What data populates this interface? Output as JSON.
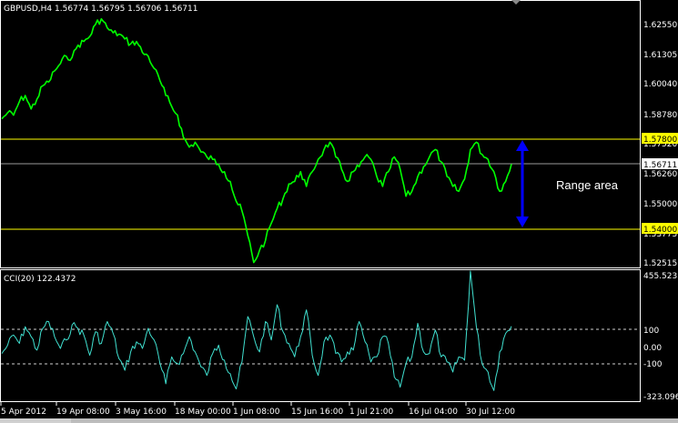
{
  "main_panel": {
    "title": "GBPUSD,H4  1.56774 1.56795 1.56706 1.56711",
    "price_labels": [
      "1.62550",
      "1.61305",
      "1.60040",
      "1.58780",
      "1.57520",
      "1.56260",
      "1.55000",
      "1.53775",
      "1.52515"
    ],
    "current_price": "1.56711",
    "upper_level": "1.57800",
    "lower_level": "1.54000",
    "annotation": "Range area"
  },
  "cci_panel": {
    "title": "CCI(20) 122.4372",
    "labels": [
      "455.5233",
      "100",
      "0.00",
      "-100",
      "-323.096"
    ]
  },
  "time_axis": {
    "labels": [
      "5 Apr 2012",
      "19 Apr 08:00",
      "3 May 16:00",
      "18 May 00:00",
      "1 Jun 08:00",
      "15 Jun 16:00",
      "1 Jul 21:00",
      "16 Jul 04:00",
      "30 Jul 12:00"
    ]
  },
  "colors": {
    "price_line": "#00ff00",
    "cci_line": "#40e0d0",
    "level_line": "#ffff00",
    "arrow": "#0000ff",
    "frame": "#ffffff"
  },
  "chart_data": [
    {
      "type": "line",
      "series": [
        {
          "values": [
            1.5855,
            1.588,
            1.587,
            1.5925,
            1.595,
            1.5895,
            1.5935,
            1.599,
            1.6005,
            1.605,
            1.608,
            1.611,
            1.6105,
            1.6155,
            1.617,
            1.619,
            1.624,
            1.6262,
            1.6225,
            1.6205,
            1.62,
            1.618,
            1.616,
            1.617,
            1.6125,
            1.611,
            1.606,
            1.601,
            1.595,
            1.5905,
            1.587,
            1.578,
            1.574,
            1.576,
            1.572,
            1.57,
            1.569,
            1.567,
            1.564,
            1.56,
            1.552,
            1.548,
            1.538,
            1.527,
            1.532,
            1.536,
            1.543,
            1.549,
            1.553,
            1.559,
            1.56,
            1.564,
            1.558,
            1.564,
            1.569,
            1.573,
            1.576,
            1.57,
            1.565,
            1.56,
            1.564,
            1.566,
            1.57,
            1.569,
            1.562,
            1.558,
            1.564,
            1.57,
            1.565,
            1.554,
            1.556,
            1.562,
            1.566,
            1.57,
            1.573,
            1.568,
            1.562,
            1.558,
            1.556,
            1.561,
            1.573,
            1.576,
            1.571,
            1.569,
            1.564,
            1.556,
            1.56,
            1.5671
          ]
        }
      ],
      "ylim": [
        1.525,
        1.6335
      ],
      "title": "GBPUSD,H4  1.56774 1.56795 1.56706 1.56711"
    },
    {
      "type": "line",
      "series": [
        {
          "values": [
            -40,
            10,
            70,
            20,
            120,
            60,
            -20,
            110,
            150,
            60,
            -10,
            40,
            130,
            110,
            70,
            -50,
            90,
            20,
            150,
            80,
            -70,
            -140,
            -30,
            30,
            -10,
            110,
            40,
            -100,
            -220,
            -60,
            -100,
            -40,
            60,
            -30,
            -120,
            -170,
            -40,
            10,
            -80,
            -160,
            -250,
            -90,
            180,
            60,
            -30,
            150,
            40,
            250,
            90,
            20,
            -60,
            60,
            220,
            -50,
            -170,
            30,
            70,
            -40,
            -90,
            -30,
            -20,
            150,
            30,
            -90,
            -60,
            60,
            20,
            -180,
            -240,
            -100,
            -60,
            140,
            -30,
            -40,
            100,
            -60,
            -90,
            -150,
            -60,
            -80,
            450,
            120,
            -100,
            -150,
            -260,
            -30,
            80,
            122
          ]
        }
      ],
      "ylim": [
        -323.096,
        455.5233
      ],
      "title": "CCI(20) 122.4372"
    }
  ]
}
